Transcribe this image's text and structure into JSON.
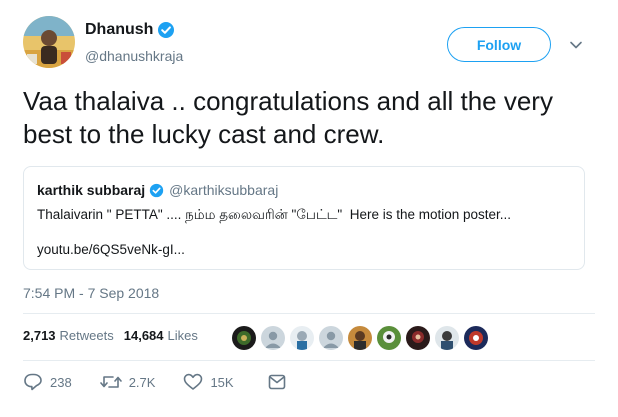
{
  "author": {
    "name": "Dhanush",
    "handle": "@dhanushkraja"
  },
  "follow_label": "Follow",
  "tweet_text": "Vaa thalaiva .. congratulations and all the very best to the lucky cast and crew.",
  "quoted": {
    "name": "karthik subbaraj",
    "handle": "@karthiksubbaraj",
    "text": "Thalaivarin \" PETTA\" .... நம்ம தலைவரின் \"பேட்ட\"  Here is the motion poster...",
    "link": "youtu.be/6QS5veNk-gI..."
  },
  "timestamp": "7:54 PM - 7 Sep 2018",
  "stats": {
    "retweets_count": "2,713",
    "retweets_label": "Retweets",
    "likes_count": "14,684",
    "likes_label": "Likes"
  },
  "actions": {
    "replies": "238",
    "retweets": "2.7K",
    "likes": "15K"
  },
  "colors": {
    "accent": "#1da1f2",
    "secondary_text": "#657786"
  },
  "icons": [
    "verified-icon",
    "chevron-down-icon",
    "reply-icon",
    "retweet-icon",
    "heart-icon",
    "message-icon"
  ]
}
